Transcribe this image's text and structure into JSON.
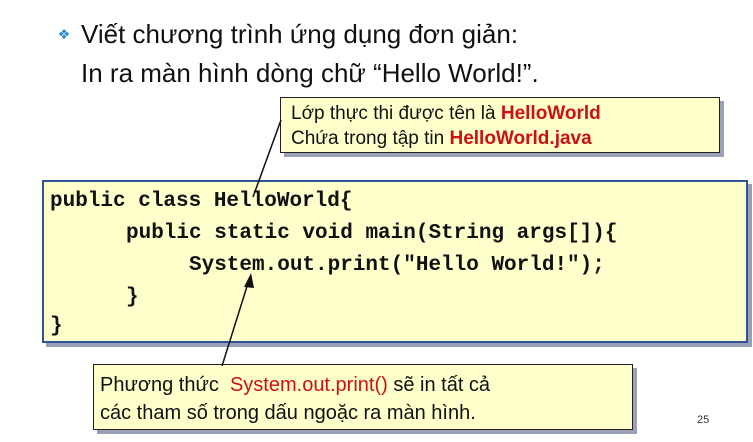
{
  "slide": {
    "bullet": {
      "icon": "diamond-bullet-icon",
      "text": "Viết chương trình ứng dụng đơn giản:"
    },
    "line2": "In ra màn hình dòng chữ “Hello World!”."
  },
  "callout_top": {
    "line1_prefix": "Lớp thực thi được tên là ",
    "line1_highlight": "HelloWorld",
    "line2_prefix": "Chứa trong tập tin ",
    "line2_highlight": "HelloWorld.java"
  },
  "code": {
    "lines": [
      "public class HelloWorld{",
      "public static void main(String args[]){",
      "System.out.print(\"Hello World!\");",
      "}",
      "}"
    ]
  },
  "callout_bottom": {
    "line1_prefix": "Phương thức  ",
    "line1_highlight": "System.out.print()",
    "line1_suffix": " sẽ in tất cả",
    "line2": "các tham số trong dấu ngoặc ra màn hình."
  },
  "page_number": "25",
  "colors": {
    "highlight": "#cc1111",
    "box_fill": "#ffffcc",
    "code_border": "#2f5597",
    "bullet": "#2b8bd1"
  }
}
